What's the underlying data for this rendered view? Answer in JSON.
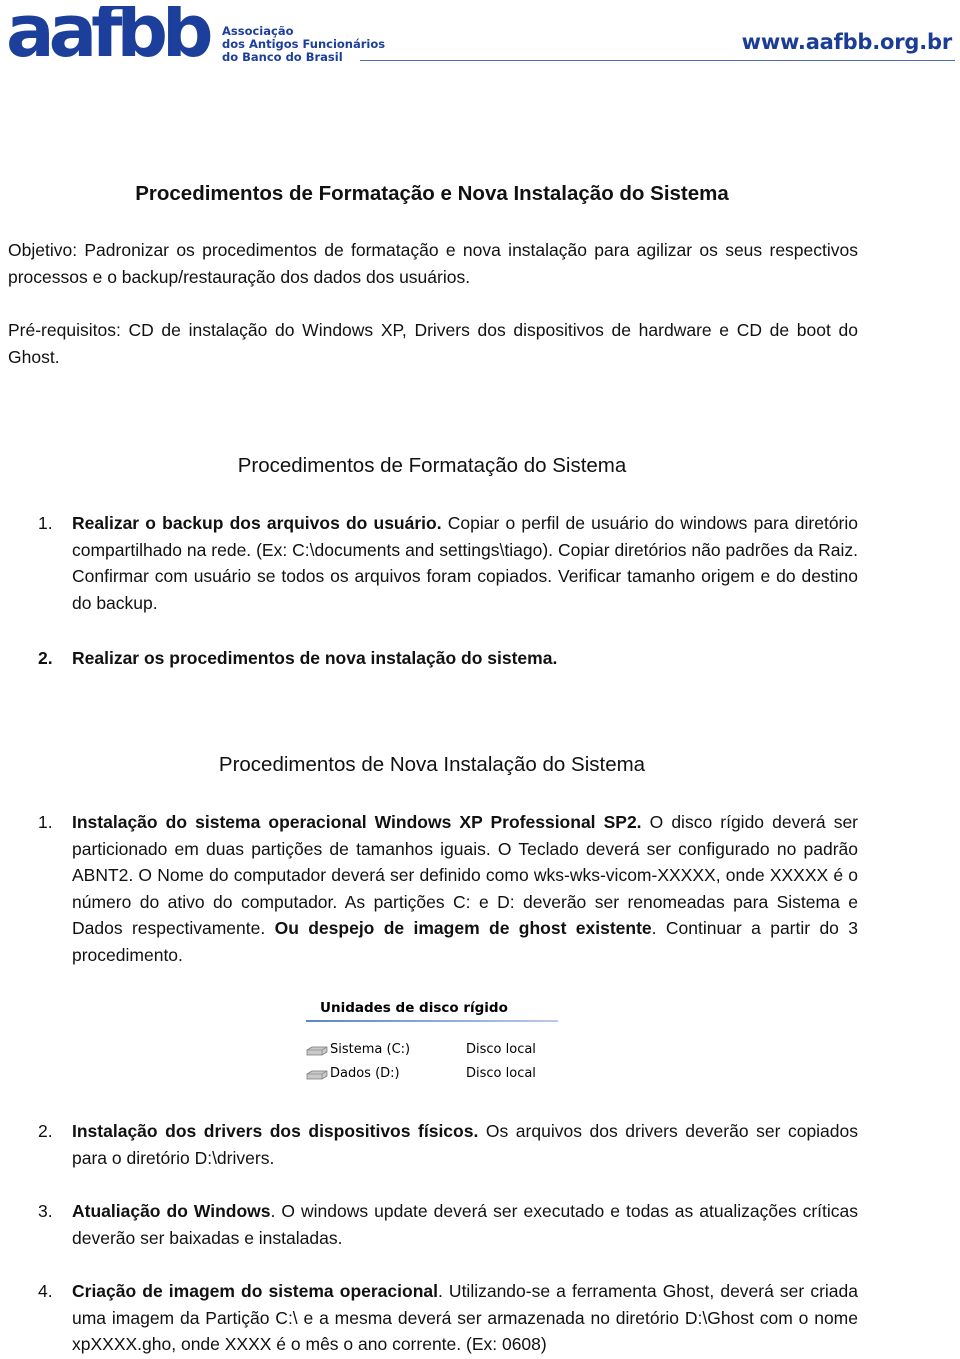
{
  "header": {
    "logo_text": "aafbb",
    "org_name_lines": [
      "Associação",
      "dos Antigos Funcionários",
      "do Banco do Brasil"
    ],
    "url": "www.aafbb.org.br",
    "brand_color": "#1d3f9c"
  },
  "document": {
    "title": "Procedimentos de Formatação e Nova Instalação do Sistema",
    "objective": "Objetivo: Padronizar os procedimentos de formatação e nova instalação para agilizar os seus respectivos processos e o backup/restauração dos dados dos usuários.",
    "prerequisites": "Pré-requisitos: CD de instalação do Windows XP, Drivers dos dispositivos de hardware e CD de boot do Ghost.",
    "section_formatting": {
      "title": "Procedimentos de Formatação do Sistema",
      "items": [
        {
          "number": "1.",
          "bold": "Realizar o backup dos arquivos do usuário.",
          "text": " Copiar o perfil de usuário do windows para diretório compartilhado na rede. (Ex: C:\\documents and settings\\tiago). Copiar diretórios não padrões da Raiz. Confirmar com usuário se todos os arquivos foram copiados. Verificar tamanho origem e do destino do backup."
        },
        {
          "number": "2.",
          "bold": "Realizar os procedimentos de nova instalação do sistema.",
          "text": ""
        }
      ]
    },
    "section_install": {
      "title": "Procedimentos de Nova Instalação do Sistema",
      "items": [
        {
          "number": "1.",
          "bold": "Instalação do sistema operacional Windows XP Professional SP2.",
          "text": " O disco rígido deverá ser particionado em duas partições de tamanhos iguais. O Teclado deverá ser configurado no padrão ABNT2. O Nome do computador deverá ser definido como wks-wks-vicom-XXXXX, onde XXXXX é o número do ativo do computador. As partições C: e D: deverão ser renomeadas para Sistema e Dados respectivamente. ",
          "bold2": "Ou despejo de imagem de ghost existente",
          "text2": ". Continuar a partir do 3 procedimento."
        },
        {
          "number": "2.",
          "bold": "Instalação dos drivers dos dispositivos físicos.",
          "text": " Os arquivos dos drivers deverão ser copiados para o diretório D:\\drivers."
        },
        {
          "number": "3.",
          "bold": "Atualiação do Windows",
          "text": ". O windows update deverá ser executado e todas as atualizações críticas deverão ser baixadas e instaladas."
        },
        {
          "number": "4.",
          "bold": "Criação de imagem do sistema operacional",
          "text": ". Utilizando-se a ferramenta Ghost, deverá ser criada uma imagem da Partição C:\\ e a mesma deverá ser armazenada no diretório D:\\Ghost com o nome xpXXXX.gho, onde XXXX é o mês o ano corrente. (Ex: 0608)"
        }
      ]
    },
    "disk_panel": {
      "title": "Unidades de disco rígido",
      "drives": [
        {
          "name": "Sistema (C:)",
          "type": "Disco local",
          "icon": "hard-drive-icon"
        },
        {
          "name": "Dados (D:)",
          "type": "Disco local",
          "icon": "hard-drive-icon"
        }
      ]
    }
  }
}
